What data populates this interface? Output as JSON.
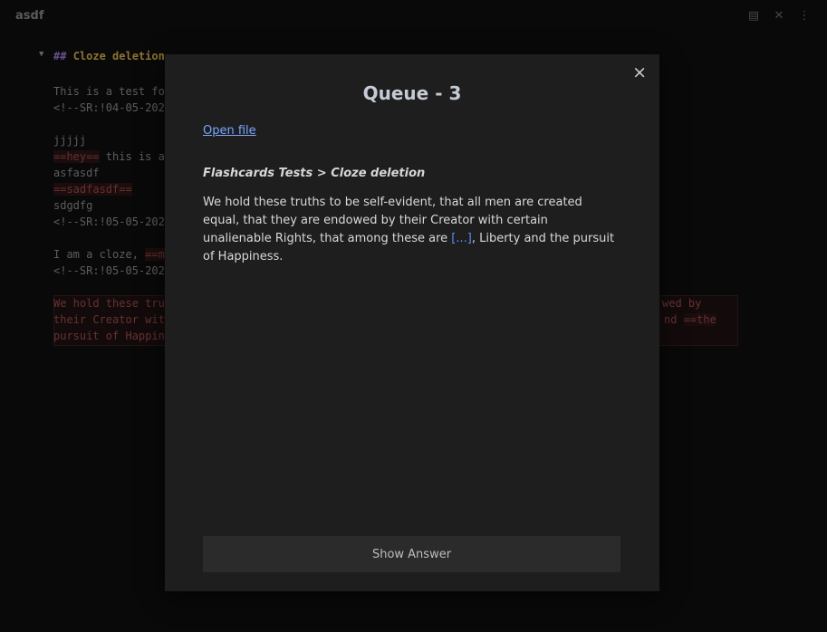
{
  "window": {
    "tab_title": "asdf"
  },
  "top_icons": [
    "reading-view-icon",
    "close-icon",
    "more-options-icon"
  ],
  "editor": {
    "heading_hash": "##",
    "heading_text": "Cloze deletion",
    "line_test": "This is a test fo",
    "line_sr1": "<!--SR:!04-05-202",
    "line_jjjjj": "jjjjj",
    "hey": "==hey==",
    "line_this_is": " this is a",
    "line_asfasdf": "asfasdf",
    "sadfasdf": "==sadfasdf==",
    "line_sdgdfg": "sdgdfg",
    "line_sr2": "<!--SR:!05-05-202",
    "line_cloze": "I am a cloze, ",
    "cloze_frag": "==m",
    "line_sr3": "<!--SR:!05-05-202",
    "block1_left": "We hold these tru",
    "block1_right": "wed by",
    "block2_left": "their Creator wit",
    "block2_right_and": "nd ",
    "block2_right_hl": "==the",
    "block3_left": "pursuit of Happin"
  },
  "modal": {
    "title": "Queue - 3",
    "close_symbol": "×",
    "open_file_label": "Open file",
    "breadcrumb": "Flashcards Tests > Cloze deletion",
    "card_text_before": "We hold these truths to be self-evident, that all men are created equal, that they are endowed by their Creator with certain unalienable Rights, that among these are ",
    "cloze_placeholder": "[...]",
    "card_text_after": ", Liberty and the pursuit of Happiness.",
    "show_answer_label": "Show Answer"
  }
}
